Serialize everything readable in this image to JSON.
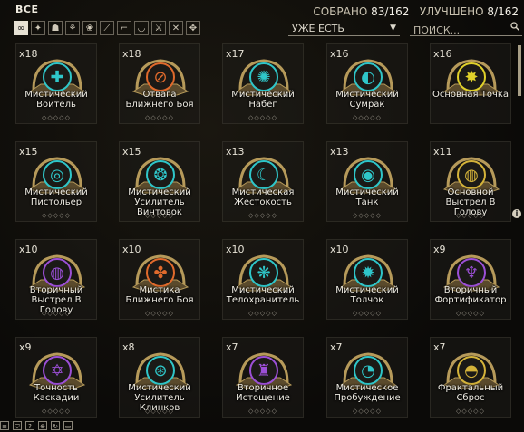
{
  "header": {
    "title": "ВСЕ",
    "collected_label": "СОБРАНО",
    "collected_value": "83/162",
    "upgraded_label": "УЛУЧШЕНО",
    "upgraded_value": "8/162"
  },
  "filters": [
    {
      "icon": "all-icon",
      "glyph": "∞"
    },
    {
      "icon": "wing-icon",
      "glyph": "✦"
    },
    {
      "icon": "helmet-icon",
      "glyph": "☗"
    },
    {
      "icon": "lotus-icon",
      "glyph": "⚘"
    },
    {
      "icon": "flower-icon",
      "glyph": "❀"
    },
    {
      "icon": "rifle-icon",
      "glyph": "⟋"
    },
    {
      "icon": "pistol-icon",
      "glyph": "⌐"
    },
    {
      "icon": "melee-icon",
      "glyph": "◡"
    },
    {
      "icon": "blade-icon",
      "glyph": "⚔"
    },
    {
      "icon": "crossed-icon",
      "glyph": "✕"
    },
    {
      "icon": "pet-icon",
      "glyph": "✥"
    }
  ],
  "dropdown": {
    "value": "УЖЕ ЕСТЬ"
  },
  "search": {
    "placeholder": "ПОИСК..."
  },
  "colors": {
    "accent": "#2fc6c9",
    "gold": "#b69a5a",
    "orange": "#e06a2c",
    "purple": "#9b4fd6",
    "yellow": "#e0d12a"
  },
  "cards": [
    {
      "count": "x18",
      "name": "Мистический Воитель",
      "color": "#2fc6c9",
      "glyph": "✚",
      "rank": "◇◇◇◇◇"
    },
    {
      "count": "x18",
      "name": "Отвага Ближнего Боя",
      "color": "#e06a2c",
      "glyph": "⊘",
      "rank": "◇◇◇◇◇"
    },
    {
      "count": "x17",
      "name": "Мистический Набег",
      "color": "#2fc6c9",
      "glyph": "✺",
      "rank": "◇◇◇◇◇"
    },
    {
      "count": "x16",
      "name": "Мистический Сумрак",
      "color": "#2fc6c9",
      "glyph": "◐",
      "rank": "◇◇◇◇◇"
    },
    {
      "count": "x16",
      "name": "Основная Точка",
      "color": "#e0d12a",
      "glyph": "✸",
      "rank": ""
    },
    {
      "count": "x15",
      "name": "Мистический Пистольер",
      "color": "#2fc6c9",
      "glyph": "◎",
      "rank": "◇◇◇◇◇"
    },
    {
      "count": "x15",
      "name": "Мистический Усилитель Винтовок",
      "color": "#2fc6c9",
      "glyph": "❂",
      "rank": "◇◇◇◇◇"
    },
    {
      "count": "x13",
      "name": "Мистическая Жестокость",
      "color": "#2fc6c9",
      "glyph": "☾",
      "rank": "◇◇◇◇◇"
    },
    {
      "count": "x13",
      "name": "Мистический Танк",
      "color": "#2fc6c9",
      "glyph": "◉",
      "rank": "◇◇◇◇◇"
    },
    {
      "count": "x11",
      "name": "Основной Выстрел В Голову",
      "color": "#d4b33a",
      "glyph": "◍",
      "rank": "◇◇◇◇◇"
    },
    {
      "count": "x10",
      "name": "Вторичный Выстрел В Голову",
      "color": "#9b4fd6",
      "glyph": "◍",
      "rank": "◇◇◇◇◇"
    },
    {
      "count": "x10",
      "name": "Мистика Ближнего Боя",
      "color": "#e06a2c",
      "glyph": "✤",
      "rank": "◇◇◇◇◇"
    },
    {
      "count": "x10",
      "name": "Мистический Телохранитель",
      "color": "#2fc6c9",
      "glyph": "❋",
      "rank": "◇◇◇◇◇"
    },
    {
      "count": "x10",
      "name": "Мистический Толчок",
      "color": "#2fc6c9",
      "glyph": "✹",
      "rank": "◇◇◇◇◇"
    },
    {
      "count": "x9",
      "name": "Вторичный Фортификатор",
      "color": "#9b4fd6",
      "glyph": "♆",
      "rank": "◇◇◇◇◇"
    },
    {
      "count": "x9",
      "name": "Точность Каскадии",
      "color": "#9b4fd6",
      "glyph": "✡",
      "rank": "◇◇◇◇◇"
    },
    {
      "count": "x8",
      "name": "Мистический Усилитель Клинков",
      "color": "#2fc6c9",
      "glyph": "⊛",
      "rank": "◇◇◇◇◇"
    },
    {
      "count": "x7",
      "name": "Вторичное Истощение",
      "color": "#9b4fd6",
      "glyph": "♜",
      "rank": "◇◇◇◇◇"
    },
    {
      "count": "x7",
      "name": "Мистическое Пробуждение",
      "color": "#2fc6c9",
      "glyph": "◔",
      "rank": "◇◇◇◇◇"
    },
    {
      "count": "x7",
      "name": "Фрактальный Сброс",
      "color": "#d4b33a",
      "glyph": "◓",
      "rank": "◇◇◇◇◇"
    }
  ],
  "bottom_bar": [
    {
      "icon": "list-icon",
      "glyph": "≡"
    },
    {
      "icon": "shield-icon",
      "glyph": "⛉"
    },
    {
      "icon": "help-icon",
      "glyph": "?"
    },
    {
      "icon": "zoom-icon",
      "glyph": "⊕"
    },
    {
      "icon": "refresh-icon",
      "glyph": "↻"
    },
    {
      "icon": "window-icon",
      "glyph": "▭"
    }
  ]
}
